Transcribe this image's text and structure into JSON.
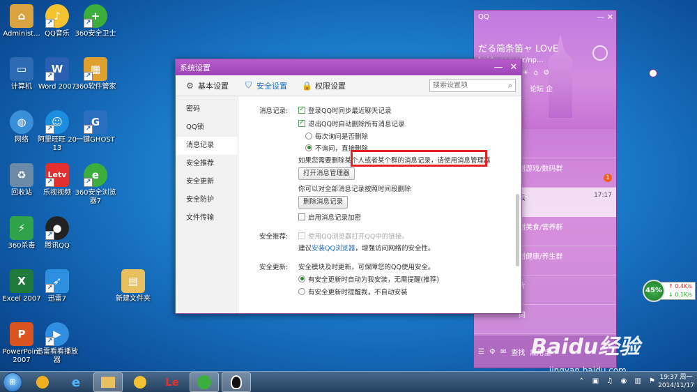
{
  "desktop": {
    "icons": [
      {
        "label": "Administ...",
        "icon": "user-folder-icon",
        "color": "#d9a440"
      },
      {
        "label": "QQ音乐",
        "icon": "qq-music-icon",
        "color": "#f2c230"
      },
      {
        "label": "360安全卫士",
        "icon": "360-guard-icon",
        "color": "#3cae3c"
      },
      {
        "label": "计算机",
        "icon": "computer-icon",
        "color": "#2d6ab4"
      },
      {
        "label": "Word 2007",
        "icon": "word-icon",
        "color": "#2b5fb3"
      },
      {
        "label": "360软件管家",
        "icon": "360-software-icon",
        "color": "#e0a030"
      },
      {
        "label": "网络",
        "icon": "network-icon",
        "color": "#3a8fd9"
      },
      {
        "label": "阿里旺旺 2013",
        "icon": "aliwangwang-icon",
        "color": "#1c8ee0"
      },
      {
        "label": "一键GHOST",
        "icon": "ghost-icon",
        "color": "#2a6ec0"
      },
      {
        "label": "回收站",
        "icon": "recycle-bin-icon",
        "color": "#6a8aa8"
      },
      {
        "label": "乐视视频",
        "icon": "letv-icon",
        "color": "#e23030"
      },
      {
        "label": "360安全浏览器7",
        "icon": "360-browser-icon",
        "color": "#3cae3c"
      },
      {
        "label": "360杀毒",
        "icon": "360-antivirus-icon",
        "color": "#2fa34a"
      },
      {
        "label": "腾讯QQ",
        "icon": "qq-penguin-icon",
        "color": "#222222"
      },
      {
        "label": "Excel 2007",
        "icon": "excel-icon",
        "color": "#1f7a3c"
      },
      {
        "label": "迅雷7",
        "icon": "thunder-icon",
        "color": "#2d8fe0"
      },
      {
        "label": "新建文件夹",
        "icon": "folder-icon",
        "color": "#e8c060"
      },
      {
        "label": "PowerPoint 2007",
        "icon": "powerpoint-icon",
        "color": "#d9541e"
      },
      {
        "label": "迅雷看看播放器",
        "icon": "xunlei-player-icon",
        "color": "#2f8ee0"
      }
    ]
  },
  "settings": {
    "title": "系统设置",
    "tabs": [
      {
        "label": "基本设置",
        "icon": "gear-icon"
      },
      {
        "label": "安全设置",
        "icon": "shield-icon"
      },
      {
        "label": "权限设置",
        "icon": "lock-icon"
      }
    ],
    "search_placeholder": "搜索设置项",
    "nav": [
      "密码",
      "QQ锁",
      "消息记录",
      "安全推荐",
      "安全更新",
      "安全防护",
      "文件传输"
    ],
    "msg_label": "消息记录:",
    "opt_sync": "登录QQ时同步最近聊天记录",
    "opt_delete": "退出QQ时自动删除所有消息记录",
    "radio_ask": "每次询问是否删除",
    "radio_noask": "不询问，直接删除",
    "hint_manager": "如果您需要删除某个人或者某个群的消息记录，请使用消息管理器",
    "btn_manager": "打开消息管理器",
    "hint_time": "你可以对全部消息记录按照时间段删除",
    "btn_delete": "删除消息记录",
    "opt_encrypt": "启用消息记录加密",
    "rec_label": "安全推荐:",
    "rec_opt": "使用QQ浏览器打开QQ中的链接。",
    "rec_hint_pre": "建议",
    "rec_link": "安装QQ浏览器",
    "rec_hint_post": "，增强访问网络的安全性。",
    "upd_label": "安全更新:",
    "upd_desc": "安全模块及时更新，可保障您的QQ使用安全。",
    "upd_auto": "有安全更新时自动为我安装，无需提醒(推荐)",
    "upd_remind": "有安全更新时提醒我，不自动安装"
  },
  "qq_panel": {
    "logo": "QQ",
    "nickname": "だる简条笛ャ LOvE",
    "signature": "baidu.comser/np...",
    "tab_labels": "论坛  企",
    "chats": [
      {
        "name": "",
        "msg": "",
        "time": "",
        "badge": ""
      },
      {
        "name": "划游戏/数码群",
        "msg": "",
        "time": "",
        "badge": "1"
      },
      {
        "name": "云",
        "msg": "",
        "time": "17:17",
        "badge": ""
      },
      {
        "name": "划美食/营养群",
        "msg": "",
        "time": "",
        "badge": ""
      },
      {
        "name": "划健康/养生群",
        "msg": "",
        "time": "",
        "badge": ""
      },
      {
        "name": "片",
        "msg": "",
        "time": "",
        "badge": ""
      },
      {
        "name": "同",
        "msg": "",
        "time": "",
        "badge": ""
      }
    ],
    "bottom_find": "查找",
    "bottom_app": "应用宝"
  },
  "meter": {
    "percent": "45%",
    "up": "0.4K/s",
    "down": "0.1K/s"
  },
  "watermark": {
    "brand": "Baidu经验",
    "url": "jingyan.baidu.com"
  },
  "taskbar": {
    "apps": [
      {
        "label": "",
        "icon": "360-icon"
      },
      {
        "label": "",
        "icon": "ie-icon"
      },
      {
        "label": "",
        "icon": "explorer-icon"
      },
      {
        "label": "",
        "icon": "qq-music-taskbar-icon"
      },
      {
        "label": "Le",
        "icon": "letv-taskbar-icon"
      },
      {
        "label": "",
        "icon": "360-browser-taskbar-icon"
      },
      {
        "label": "",
        "icon": "qq-taskbar-icon"
      }
    ],
    "time": "19:37 周一",
    "date": "2014/11/17"
  }
}
